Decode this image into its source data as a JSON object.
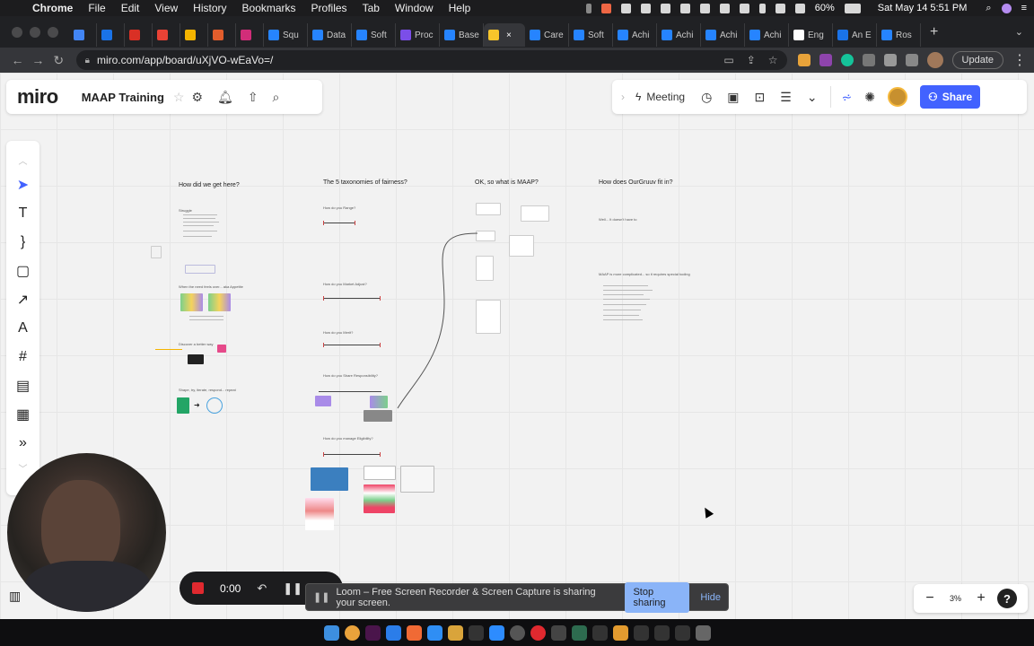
{
  "menubar": {
    "app_name": "Chrome",
    "items": [
      "File",
      "Edit",
      "View",
      "History",
      "Bookmarks",
      "Profiles",
      "Tab",
      "Window",
      "Help"
    ],
    "battery": "60%",
    "datetime": "Sat May 14  5:51 PM"
  },
  "tabs": [
    {
      "label": "",
      "color": "#4285f4"
    },
    {
      "label": "",
      "color": "#1a73e8"
    },
    {
      "label": "",
      "color": "#d93025"
    },
    {
      "label": "",
      "color": "#e94235"
    },
    {
      "label": "",
      "color": "#f4b400"
    },
    {
      "label": "",
      "color": "#e25d2c"
    },
    {
      "label": "",
      "color": "#d12d79"
    },
    {
      "label": "Squ",
      "color": "#2684ff"
    },
    {
      "label": "Data",
      "color": "#2684ff"
    },
    {
      "label": "Soft",
      "color": "#2684ff"
    },
    {
      "label": "Proc",
      "color": "#7b4ee8"
    },
    {
      "label": "Base",
      "color": "#2684ff"
    },
    {
      "label": "",
      "color": "#f7c52b",
      "active": true
    },
    {
      "label": "Care",
      "color": "#2684ff"
    },
    {
      "label": "Soft",
      "color": "#2684ff"
    },
    {
      "label": "Achi",
      "color": "#2684ff"
    },
    {
      "label": "Achi",
      "color": "#2684ff"
    },
    {
      "label": "Achi",
      "color": "#2684ff"
    },
    {
      "label": "Achi",
      "color": "#2684ff"
    },
    {
      "label": "Eng",
      "color": "#ffffff"
    },
    {
      "label": "An E",
      "color": "#1a73e8"
    },
    {
      "label": "Ros",
      "color": "#2684ff"
    }
  ],
  "browser": {
    "url": "miro.com/app/board/uXjVO-wEaVo=/",
    "update_label": "Update"
  },
  "miro": {
    "logo": "miro",
    "board_title": "MAAP Training",
    "meeting_label": "Meeting",
    "share_label": "Share",
    "zoom": "3%",
    "help": "?"
  },
  "board": {
    "frames": [
      {
        "title": "How did we get here?"
      },
      {
        "title": "The 5 taxonomies of fairness?"
      },
      {
        "title": "OK, so what is MAAP?"
      },
      {
        "title": "How does OurGruuv fit in?"
      }
    ],
    "fairness_rows": [
      "How do you Range?",
      "How do you Market Adjust?",
      "How do you Merit?",
      "How do you Share Responsibility?",
      "How do you manage Eligibility?"
    ],
    "history_notes": [
      "Struggle",
      "When the need feels over... aka Appetite",
      "Discover a better way",
      "Shape, try, iterate, respond... repeat"
    ],
    "ourgruuv_notes": [
      "Well... It doesn't have to",
      "MAAP is more complicated... so it requires special tooling"
    ]
  },
  "recorder": {
    "time": "0:00"
  },
  "share_banner": {
    "text": "Loom – Free Screen Recorder & Screen Capture is sharing your screen.",
    "stop_label": "Stop sharing",
    "hide_label": "Hide"
  },
  "colors": {
    "miro_accent": "#4262ff",
    "record_red": "#e0292f",
    "chrome_blue": "#8ab4f8"
  }
}
